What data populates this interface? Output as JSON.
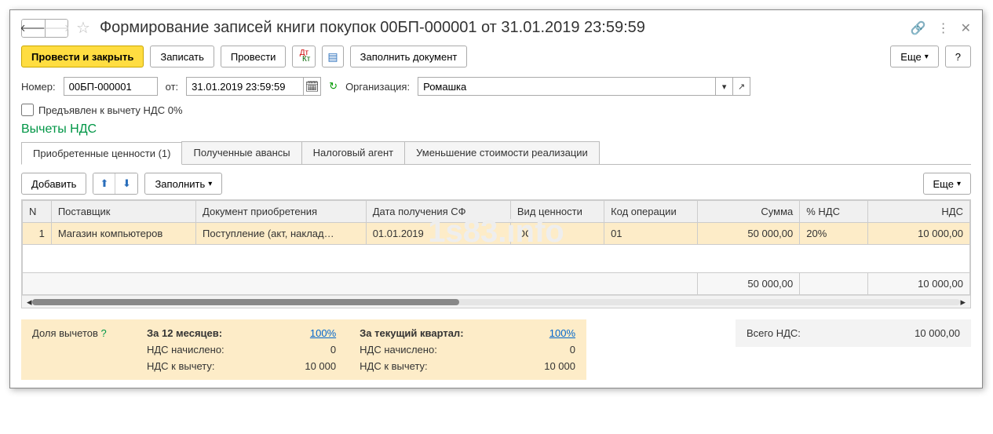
{
  "header": {
    "title": "Формирование записей книги покупок 00БП-000001 от 31.01.2019 23:59:59"
  },
  "toolbar": {
    "post_close": "Провести и закрыть",
    "save": "Записать",
    "post": "Провести",
    "fill_doc": "Заполнить документ",
    "more": "Еще",
    "help": "?"
  },
  "form": {
    "number_label": "Номер:",
    "number_value": "00БП-000001",
    "date_from_label": "от:",
    "date_value": "31.01.2019 23:59:59",
    "org_label": "Организация:",
    "org_value": "Ромашка",
    "vat0_checkbox": "Предъявлен к вычету НДС 0%"
  },
  "section": {
    "title": "Вычеты НДС"
  },
  "tabs": {
    "t1": "Приобретенные ценности (1)",
    "t2": "Полученные авансы",
    "t3": "Налоговый агент",
    "t4": "Уменьшение стоимости реализации"
  },
  "table_toolbar": {
    "add": "Добавить",
    "fill": "Заполнить",
    "more": "Еще"
  },
  "grid": {
    "headers": {
      "n": "N",
      "supplier": "Поставщик",
      "doc": "Документ приобретения",
      "sf_date": "Дата получения СФ",
      "value_type": "Вид ценности",
      "op_code": "Код операции",
      "sum": "Сумма",
      "vat_pct": "% НДС",
      "vat": "НДС"
    },
    "row": {
      "n": "1",
      "supplier": "Магазин компьютеров",
      "doc": "Поступление (акт, наклад…",
      "sf_date": "01.01.2019",
      "value_type": "ОС",
      "op_code": "01",
      "sum": "50 000,00",
      "vat_pct": "20%",
      "vat": "10 000,00"
    },
    "totals": {
      "sum": "50 000,00",
      "vat": "10 000,00"
    }
  },
  "summary": {
    "share_label": "Доля вычетов",
    "q": "?",
    "period12_label": "За 12 месяцев:",
    "period12_pct": "100%",
    "quarter_label": "За текущий квартал:",
    "quarter_pct": "100%",
    "vat_accrued_label": "НДС начислено:",
    "vat_accrued_12": "0",
    "vat_accrued_q": "0",
    "vat_deduct_label": "НДС к вычету:",
    "vat_deduct_12": "10 000",
    "vat_deduct_q": "10 000",
    "total_vat_label": "Всего НДС:",
    "total_vat_value": "10 000,00"
  },
  "watermark": "1s83.info"
}
